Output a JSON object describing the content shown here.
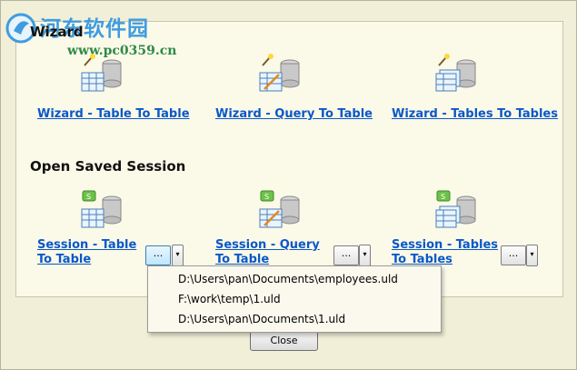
{
  "watermark": {
    "title": "河东软件园",
    "url": "www.pc0359.cn"
  },
  "sections": {
    "wizard_title": "Wizard",
    "session_title": "Open Saved Session"
  },
  "wizard_links": [
    "Wizard - Table To Table",
    "Wizard - Query To Table",
    "Wizard - Tables To Tables"
  ],
  "session_links": [
    {
      "line1": "Session - Table",
      "line2": "To Table"
    },
    {
      "line1": "Session - Query",
      "line2": "To Table"
    },
    {
      "line1": "Session - Tables",
      "line2": "To Tables"
    }
  ],
  "buttons": {
    "browse": "...",
    "dropdown": "▾",
    "close": "Close"
  },
  "recent_menu": [
    "D:\\Users\\pan\\Documents\\employees.uld",
    "F:\\work\\temp\\1.uld",
    "D:\\Users\\pan\\Documents\\1.uld"
  ],
  "colors": {
    "background": "#f1efd7",
    "link": "#0a58c9",
    "panel": "#fbf9e8"
  }
}
